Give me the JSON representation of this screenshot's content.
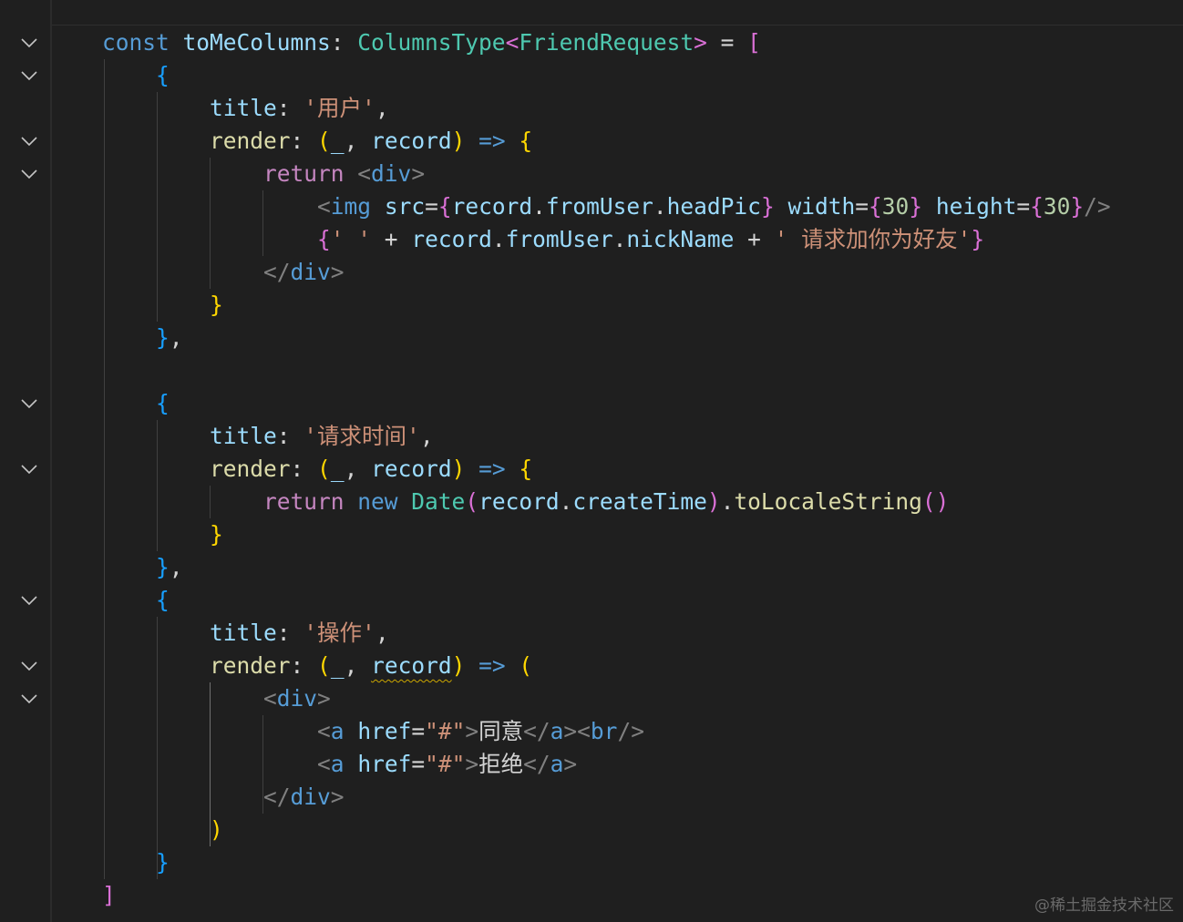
{
  "editor": {
    "lines": [
      [
        [
          "kw",
          "const "
        ],
        [
          "var",
          "toMeColumns"
        ],
        [
          "op",
          ": "
        ],
        [
          "type",
          "ColumnsType"
        ],
        [
          "b2",
          "<"
        ],
        [
          "type",
          "FriendRequest"
        ],
        [
          "b2",
          ">"
        ],
        [
          "op",
          " = "
        ],
        [
          "b2",
          "["
        ]
      ],
      [
        [
          "txt",
          "    "
        ],
        [
          "b3",
          "{"
        ]
      ],
      [
        [
          "txt",
          "        "
        ],
        [
          "var",
          "title"
        ],
        [
          "op",
          ": "
        ],
        [
          "str",
          "'用户'"
        ],
        [
          "op",
          ","
        ]
      ],
      [
        [
          "txt",
          "        "
        ],
        [
          "fn",
          "render"
        ],
        [
          "op",
          ": "
        ],
        [
          "b1",
          "("
        ],
        [
          "var",
          "_"
        ],
        [
          "op",
          ", "
        ],
        [
          "var",
          "record"
        ],
        [
          "b1",
          ")"
        ],
        [
          "kw",
          " => "
        ],
        [
          "b1",
          "{"
        ]
      ],
      [
        [
          "txt",
          "            "
        ],
        [
          "ctl",
          "return "
        ],
        [
          "tagp",
          "<"
        ],
        [
          "tag",
          "div"
        ],
        [
          "tagp",
          ">"
        ]
      ],
      [
        [
          "txt",
          "                "
        ],
        [
          "tagp",
          "<"
        ],
        [
          "tag",
          "img"
        ],
        [
          "txt",
          " "
        ],
        [
          "attr",
          "src"
        ],
        [
          "op",
          "="
        ],
        [
          "b2",
          "{"
        ],
        [
          "var",
          "record"
        ],
        [
          "op",
          "."
        ],
        [
          "var",
          "fromUser"
        ],
        [
          "op",
          "."
        ],
        [
          "var",
          "headPic"
        ],
        [
          "b2",
          "}"
        ],
        [
          "txt",
          " "
        ],
        [
          "attr",
          "width"
        ],
        [
          "op",
          "="
        ],
        [
          "b2",
          "{"
        ],
        [
          "num",
          "30"
        ],
        [
          "b2",
          "}"
        ],
        [
          "txt",
          " "
        ],
        [
          "attr",
          "height"
        ],
        [
          "op",
          "="
        ],
        [
          "b2",
          "{"
        ],
        [
          "num",
          "30"
        ],
        [
          "b2",
          "}"
        ],
        [
          "tagp",
          "/>"
        ]
      ],
      [
        [
          "txt",
          "                "
        ],
        [
          "b2",
          "{"
        ],
        [
          "str",
          "' '"
        ],
        [
          "op",
          " + "
        ],
        [
          "var",
          "record"
        ],
        [
          "op",
          "."
        ],
        [
          "var",
          "fromUser"
        ],
        [
          "op",
          "."
        ],
        [
          "var",
          "nickName"
        ],
        [
          "op",
          " + "
        ],
        [
          "str",
          "' 请求加你为好友'"
        ],
        [
          "b2",
          "}"
        ]
      ],
      [
        [
          "txt",
          "            "
        ],
        [
          "tagp",
          "</"
        ],
        [
          "tag",
          "div"
        ],
        [
          "tagp",
          ">"
        ]
      ],
      [
        [
          "txt",
          "        "
        ],
        [
          "b1",
          "}"
        ]
      ],
      [
        [
          "txt",
          "    "
        ],
        [
          "b3",
          "}"
        ],
        [
          "op",
          ","
        ]
      ],
      [],
      [
        [
          "txt",
          "    "
        ],
        [
          "b3",
          "{"
        ]
      ],
      [
        [
          "txt",
          "        "
        ],
        [
          "var",
          "title"
        ],
        [
          "op",
          ": "
        ],
        [
          "str",
          "'请求时间'"
        ],
        [
          "op",
          ","
        ]
      ],
      [
        [
          "txt",
          "        "
        ],
        [
          "fn",
          "render"
        ],
        [
          "op",
          ": "
        ],
        [
          "b1",
          "("
        ],
        [
          "var",
          "_"
        ],
        [
          "op",
          ", "
        ],
        [
          "var",
          "record"
        ],
        [
          "b1",
          ")"
        ],
        [
          "kw",
          " => "
        ],
        [
          "b1",
          "{"
        ]
      ],
      [
        [
          "txt",
          "            "
        ],
        [
          "ctl",
          "return "
        ],
        [
          "kw",
          "new "
        ],
        [
          "type",
          "Date"
        ],
        [
          "b2",
          "("
        ],
        [
          "var",
          "record"
        ],
        [
          "op",
          "."
        ],
        [
          "var",
          "createTime"
        ],
        [
          "b2",
          ")"
        ],
        [
          "op",
          "."
        ],
        [
          "fn",
          "toLocaleString"
        ],
        [
          "b2",
          "()"
        ]
      ],
      [
        [
          "txt",
          "        "
        ],
        [
          "b1",
          "}"
        ]
      ],
      [
        [
          "txt",
          "    "
        ],
        [
          "b3",
          "}"
        ],
        [
          "op",
          ","
        ]
      ],
      [
        [
          "txt",
          "    "
        ],
        [
          "b3",
          "{"
        ]
      ],
      [
        [
          "txt",
          "        "
        ],
        [
          "var",
          "title"
        ],
        [
          "op",
          ": "
        ],
        [
          "str",
          "'操作'"
        ],
        [
          "op",
          ","
        ]
      ],
      [
        [
          "txt",
          "        "
        ],
        [
          "fn",
          "render"
        ],
        [
          "op",
          ": "
        ],
        [
          "b1",
          "("
        ],
        [
          "var",
          "_"
        ],
        [
          "op",
          ", "
        ],
        [
          "var squiggle",
          "record"
        ],
        [
          "b1",
          ")"
        ],
        [
          "kw",
          " => "
        ],
        [
          "b1",
          "("
        ]
      ],
      [
        [
          "txt",
          "            "
        ],
        [
          "tagp",
          "<"
        ],
        [
          "tag",
          "div"
        ],
        [
          "tagp",
          ">"
        ]
      ],
      [
        [
          "txt",
          "                "
        ],
        [
          "tagp",
          "<"
        ],
        [
          "tag",
          "a"
        ],
        [
          "txt",
          " "
        ],
        [
          "attr",
          "href"
        ],
        [
          "op",
          "="
        ],
        [
          "str",
          "\"#\""
        ],
        [
          "tagp",
          ">"
        ],
        [
          "txt",
          "同意"
        ],
        [
          "tagp",
          "</"
        ],
        [
          "tag",
          "a"
        ],
        [
          "tagp",
          "><"
        ],
        [
          "tag",
          "br"
        ],
        [
          "tagp",
          "/>"
        ]
      ],
      [
        [
          "txt",
          "                "
        ],
        [
          "tagp",
          "<"
        ],
        [
          "tag",
          "a"
        ],
        [
          "txt",
          " "
        ],
        [
          "attr",
          "href"
        ],
        [
          "op",
          "="
        ],
        [
          "str",
          "\"#\""
        ],
        [
          "tagp",
          ">"
        ],
        [
          "txt",
          "拒绝"
        ],
        [
          "tagp",
          "</"
        ],
        [
          "tag",
          "a"
        ],
        [
          "tagp",
          ">"
        ]
      ],
      [
        [
          "txt",
          "            "
        ],
        [
          "tagp",
          "</"
        ],
        [
          "tag",
          "div"
        ],
        [
          "tagp",
          ">"
        ]
      ],
      [
        [
          "txt",
          "        "
        ],
        [
          "b1",
          ")"
        ]
      ],
      [
        [
          "txt",
          "    "
        ],
        [
          "b3",
          "}"
        ]
      ],
      [
        [
          "b2",
          "]"
        ]
      ]
    ],
    "fold_lines": [
      0,
      1,
      3,
      4,
      11,
      13,
      17,
      19,
      20
    ],
    "watermark": "@稀土掘金技术社区"
  }
}
